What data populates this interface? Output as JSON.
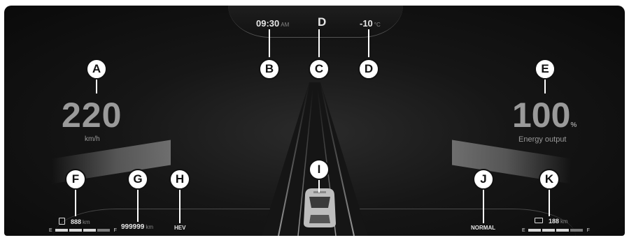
{
  "header": {
    "time": "09:30",
    "time_suffix": "AM",
    "gear": "D",
    "temperature": "-10",
    "temperature_unit": "°C"
  },
  "speed": {
    "value": "220",
    "unit": "km/h"
  },
  "energy": {
    "value": "100",
    "unit": "%",
    "label": "Energy output"
  },
  "fuel": {
    "range": "888",
    "unit": "km",
    "empty_label": "E",
    "full_label": "F",
    "level_fraction": 0.75
  },
  "battery": {
    "range": "188",
    "unit": "km",
    "empty_label": "E",
    "full_label": "F",
    "level_fraction": 0.75
  },
  "odometer": {
    "value": "999999",
    "unit": "km"
  },
  "mode_badge": "HEV",
  "drive_mode": "NORMAL",
  "callouts": {
    "a": "A",
    "b": "B",
    "c": "C",
    "d": "D",
    "e": "E",
    "f": "F",
    "g": "G",
    "h": "H",
    "i": "I",
    "j": "J",
    "k": "K"
  },
  "colors": {
    "background": "#0a0a0a",
    "text": "#e6e6e6",
    "callout_fill": "#ffffff"
  }
}
